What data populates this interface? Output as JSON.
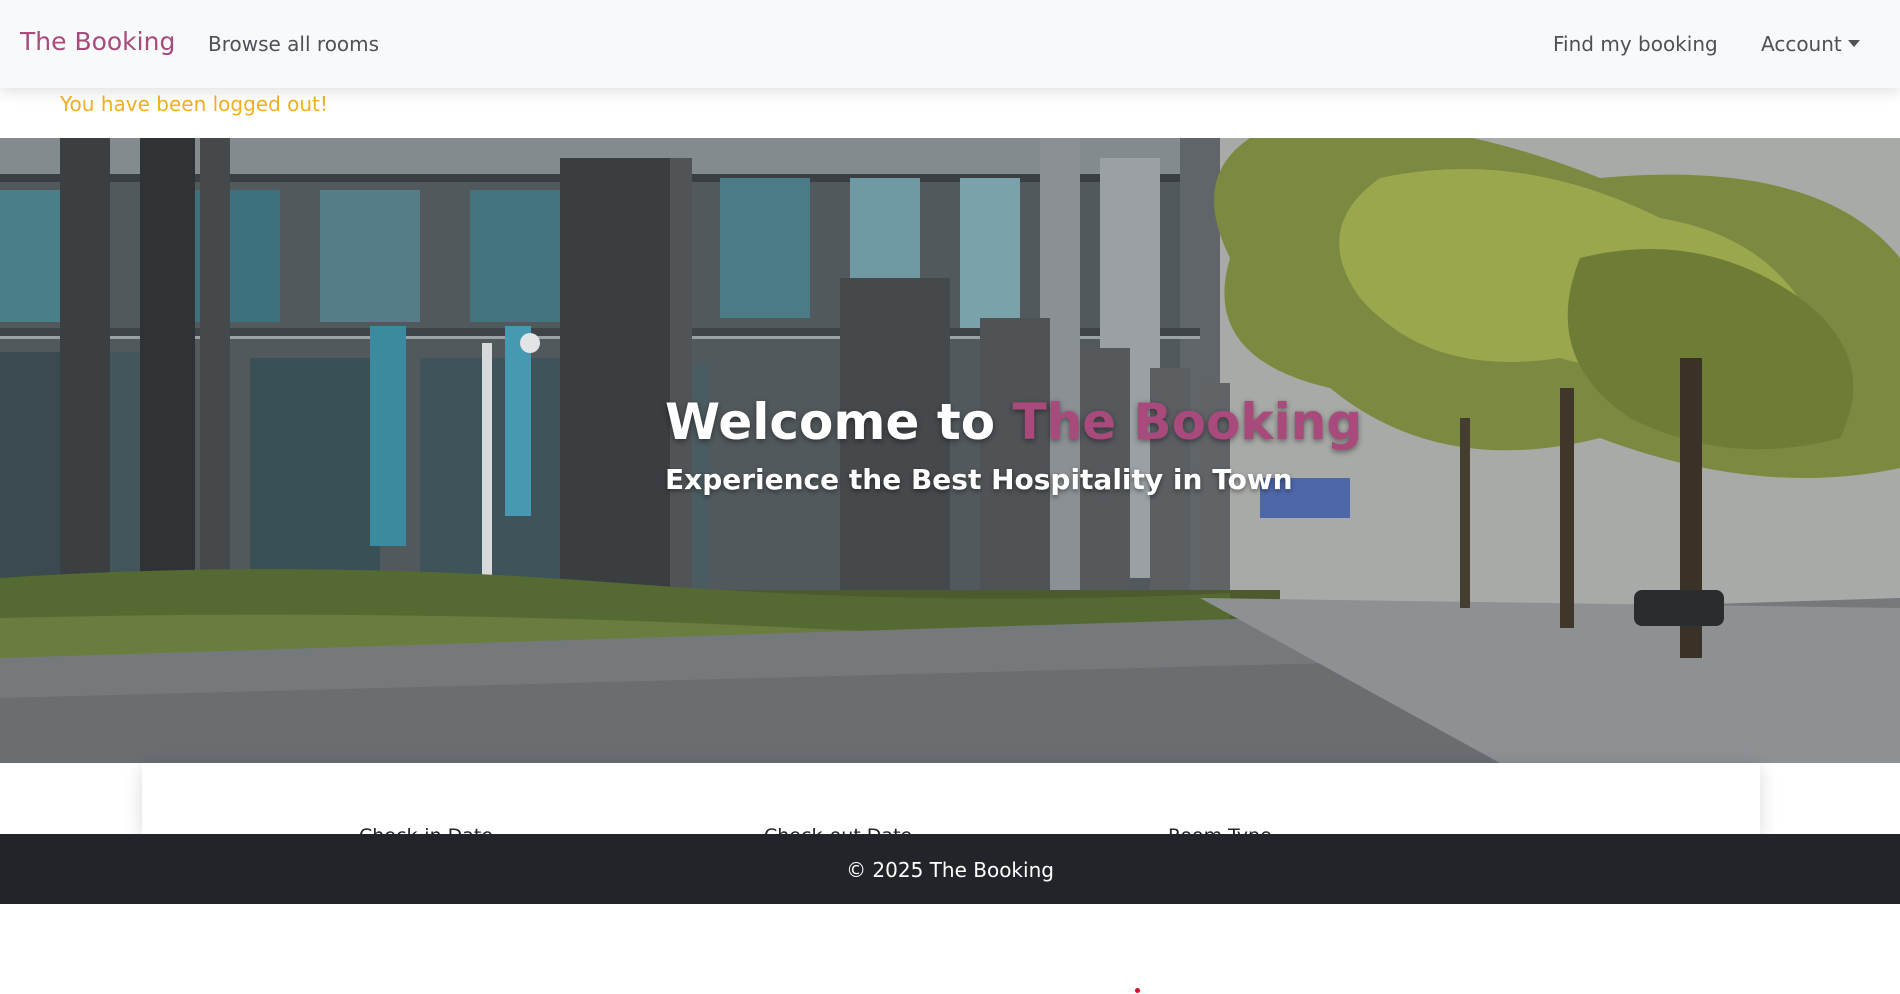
{
  "navbar": {
    "brand": "The Booking",
    "browse_link": "Browse all rooms",
    "find_link": "Find my booking",
    "account_label": "Account",
    "caret_icon": "chevron-down-icon"
  },
  "flash": {
    "message": "You have been logged out!",
    "color": "#f2b01e"
  },
  "hero": {
    "title_prefix": "Welcome to",
    "title_brand": "The Booking",
    "subtitle": "Experience the Best Hospitality in Town"
  },
  "search": {
    "checkin_label": "Check-in Date",
    "checkout_label": "Check-out Date",
    "roomtype_label": "Room Type"
  },
  "footer": {
    "copyright": "© 2025 The Booking"
  },
  "colors": {
    "brand": "#a94a7c",
    "navbar_bg": "#f8f9fa",
    "footer_bg": "#212529"
  }
}
